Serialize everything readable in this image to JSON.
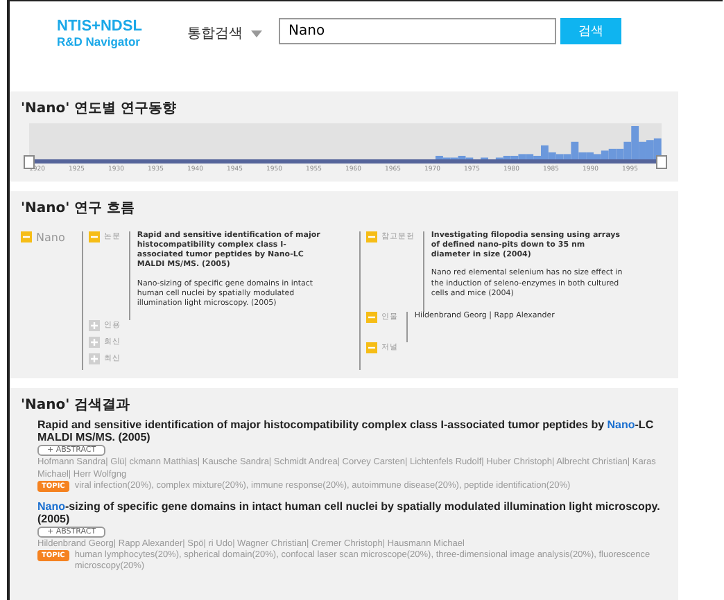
{
  "header": {
    "logo_top": "NTIS+NDSL",
    "logo_bottom": "R&D Navigator",
    "scope": "통합검색",
    "query": "Nano",
    "search_button": "검색"
  },
  "trend": {
    "title": "'Nano' 연도별 연구동향",
    "ticks": [
      "1920",
      "1925",
      "1930",
      "1935",
      "1940",
      "1945",
      "1950",
      "1955",
      "1960",
      "1965",
      "1970",
      "1975",
      "1980",
      "1985",
      "1990",
      "1995"
    ]
  },
  "flow": {
    "title": "'Nano' 연구 흐름",
    "root": {
      "label": "Nano",
      "expanded": true
    },
    "left": [
      {
        "label": "논문",
        "expanded": true,
        "items": [
          {
            "text": "Rapid and sensitive identification of major histocompatibility complex class I-associated tumor peptides by Nano-LC MALDI MS/MS. (2005)",
            "bold": true
          },
          {
            "text": "Nano-sizing of specific gene domains in intact human cell nuclei by spatially modulated illumination light microscopy. (2005)",
            "bold": false
          }
        ]
      },
      {
        "label": "인용",
        "expanded": false
      },
      {
        "label": "회신",
        "expanded": false
      },
      {
        "label": "최신",
        "expanded": false
      }
    ],
    "right": [
      {
        "label": "참고문헌",
        "expanded": true,
        "items": [
          {
            "text": "Investigating filopodia sensing using arrays of defined nano-pits down to 35 nm diameter in size (2004)",
            "bold": true
          },
          {
            "text": "Nano red elemental selenium has no size effect in the induction of seleno-enzymes in both cultured cells and mice (2004)",
            "bold": false
          }
        ]
      },
      {
        "label": "인물",
        "expanded": true,
        "items": [
          {
            "text": "Hildenbrand Georg | Rapp Alexander",
            "bold": false
          }
        ]
      },
      {
        "label": "저널",
        "expanded": true
      }
    ]
  },
  "results": {
    "title": "'Nano' 검색결과",
    "items": [
      {
        "title": [
          {
            "text": "Rapid and sensitive identification of major histocompatibility complex class I-associated tumor peptides by ",
            "highlight": false
          },
          {
            "text": "Nano",
            "highlight": true
          },
          {
            "text": "-LC MALDI MS/MS. (2005)",
            "highlight": false
          }
        ],
        "abstract": "+ ABSTRACT",
        "authors": "Hofmann Sandra| Glü| ckmann Matthias| Kausche Sandra| Schmidt Andrea| Corvey Carsten| Lichtenfels Rudolf| Huber Christoph| Albrecht Christian| Karas Michael| Herr Wolfgng",
        "topic_badge": "TOPIC",
        "topics": "viral infection(20%), complex mixture(20%), immune response(20%), autoimmune disease(20%), peptide identification(20%)"
      },
      {
        "title": [
          {
            "text": "Nano",
            "highlight": true
          },
          {
            "text": "-sizing of specific gene domains in intact human cell nuclei by spatially modulated illumination light microscopy. (2005)",
            "highlight": false
          }
        ],
        "abstract": "+ ABSTRACT",
        "authors": "Hildenbrand Georg| Rapp Alexander| Spö| ri Udo| Wagner Christian| Cremer Christoph| Hausmann Michael",
        "topic_badge": "TOPIC",
        "topics": "human lymphocytes(20%), spherical domain(20%), confocal laser scan microscope(20%), three-dimensional image analysis(20%), fluorescence microscopy(20%)"
      }
    ]
  }
}
